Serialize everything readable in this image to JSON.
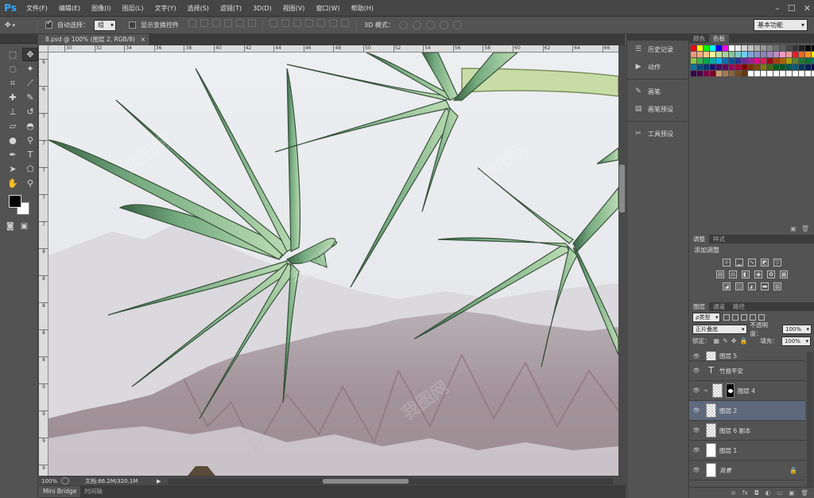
{
  "app": {
    "logo": "Ps"
  },
  "menu": [
    "文件(F)",
    "编辑(E)",
    "图像(I)",
    "图层(L)",
    "文字(Y)",
    "选择(S)",
    "滤镜(T)",
    "3D(D)",
    "视图(V)",
    "窗口(W)",
    "帮助(H)"
  ],
  "window_controls": {
    "minimize": "–",
    "maximize": "☐",
    "close": "✕"
  },
  "options": {
    "tool_icon": "move-tool-icon",
    "auto_select_label": "自动选择：",
    "auto_select_value": "组",
    "show_transform_label": "显示变换控件",
    "mode3d_label": "3D 模式："
  },
  "workspace": {
    "selected": "基本功能"
  },
  "document": {
    "tab_title": "8.psd @ 100% (图层 2, RGB/8)",
    "tab_close": "×",
    "zoom": "100%",
    "doc_info": "文档:66.2M/320.1M",
    "status_arrow": "▶"
  },
  "rulers": {
    "top": [
      "30",
      "32",
      "34",
      "36",
      "38",
      "40",
      "42",
      "44",
      "46",
      "48",
      "50",
      "52",
      "54",
      "56",
      "58",
      "60",
      "62",
      "64",
      "66"
    ],
    "left": [
      "6",
      "6",
      "7",
      "7",
      "7",
      "7",
      "7",
      "8",
      "8",
      "8",
      "8",
      "8",
      "9",
      "9",
      "9",
      "9"
    ]
  },
  "bottom_tabs": [
    "Mini Bridge",
    "时间轴"
  ],
  "collapsed_panels": [
    {
      "icon": "history-icon",
      "glyph": "☰",
      "label": "历史记录"
    },
    {
      "icon": "actions-icon",
      "glyph": "▶",
      "label": "动作"
    },
    {
      "icon": "brush-icon",
      "glyph": "✎",
      "label": "画笔"
    },
    {
      "icon": "brush-presets-icon",
      "glyph": "▤",
      "label": "画笔预设"
    },
    {
      "icon": "tool-presets-icon",
      "glyph": "✂",
      "label": "工具预设"
    }
  ],
  "swatch_tabs": [
    "颜色",
    "色板"
  ],
  "swatch_colors": [
    "#ff0000",
    "#ffff00",
    "#00ff00",
    "#00ffff",
    "#0000ff",
    "#ff00ff",
    "#ffffff",
    "#ebebeb",
    "#d6d6d6",
    "#c2c2c2",
    "#adadad",
    "#999999",
    "#858585",
    "#707070",
    "#5c5c5c",
    "#474747",
    "#333333",
    "#1f1f1f",
    "#0a0a0a",
    "#000000",
    "#f7977a",
    "#f9ad81",
    "#fdc68a",
    "#fff79a",
    "#c4df9b",
    "#a2d39c",
    "#82ca9d",
    "#7bcdc8",
    "#6ecff6",
    "#7ea7d8",
    "#8493ca",
    "#8882be",
    "#a187be",
    "#bc8dbf",
    "#f49ac2",
    "#f6989d",
    "#ed1c24",
    "#f26522",
    "#f7941d",
    "#fff200",
    "#8dc63f",
    "#39b54a",
    "#00a651",
    "#00a99d",
    "#00aeef",
    "#0072bc",
    "#0054a6",
    "#2e3192",
    "#662d91",
    "#92278f",
    "#ec008c",
    "#ed145b",
    "#9e0b0f",
    "#a0410d",
    "#a3620a",
    "#aba000",
    "#598527",
    "#197b30",
    "#007236",
    "#00746b",
    "#0076a3",
    "#004a80",
    "#003471",
    "#1b1464",
    "#440e62",
    "#630460",
    "#9e005d",
    "#9e0039",
    "#790000",
    "#7b2e00",
    "#7d4900",
    "#827b00",
    "#406618",
    "#005e20",
    "#005826",
    "#005952",
    "#005b7f",
    "#003663",
    "#002157",
    "#0d004c",
    "#32004b",
    "#4b0049",
    "#7b0046",
    "#7a0026",
    "#c69c6d",
    "#a67c52",
    "#8c6239",
    "#754c24",
    "#603913",
    "#ffffff",
    "#ffffff",
    "#ffffff",
    "#ffffff",
    "#ffffff",
    "#ffffff",
    "#ffffff",
    "#ffffff",
    "#ffffff",
    "#ffffff",
    "#ffffff"
  ],
  "adjustments": {
    "tabs": [
      "调整",
      "样式"
    ],
    "title": "添加调整"
  },
  "layers_panel": {
    "tabs": [
      "图层",
      "通道",
      "路径"
    ],
    "filter_label": "ρ类型",
    "blend_mode": "正片叠底",
    "opacity_label": "不透明度：",
    "opacity_value": "100%",
    "lock_label": "锁定：",
    "fill_label": "填充：",
    "fill_value": "100%",
    "layers": [
      {
        "name": "图层 5",
        "thumb": "checker",
        "selected": false
      },
      {
        "name": "竹报平安",
        "thumb": "text",
        "selected": false
      },
      {
        "name": "图层 4",
        "thumb": "checker",
        "mask": true,
        "selected": false
      },
      {
        "name": "图层 2",
        "thumb": "checker",
        "selected": true
      },
      {
        "name": "图层 6 副本",
        "thumb": "checker",
        "selected": false
      },
      {
        "name": "图层 1",
        "thumb": "white",
        "selected": false
      },
      {
        "name": "背景",
        "thumb": "white",
        "locked": true,
        "selected": false
      }
    ],
    "footer_icons": [
      "⊝",
      "fx",
      "◘",
      "◐",
      "▭",
      "▣",
      "🗑"
    ]
  },
  "colors": {
    "foreground": "#000000",
    "background": "#ffffff"
  }
}
